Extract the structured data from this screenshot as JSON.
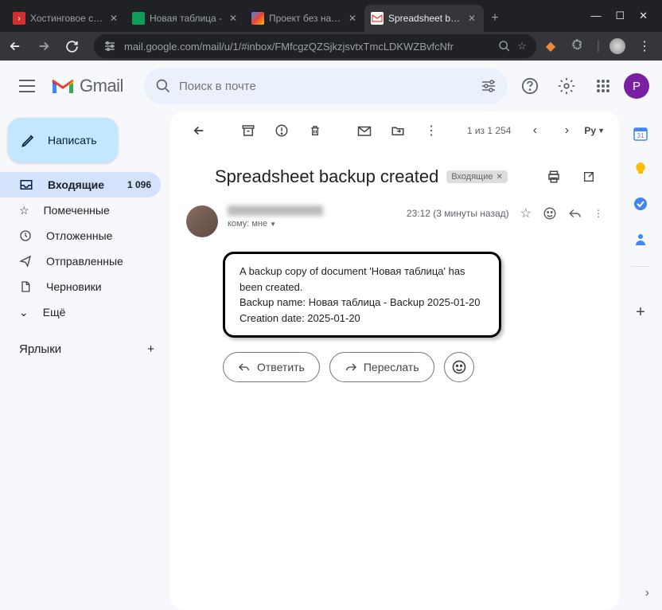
{
  "browser": {
    "tabs": [
      {
        "title": "Хостинговое со…",
        "icon_bg": "#d32f2f",
        "icon_text": ">"
      },
      {
        "title": "Новая таблица - ",
        "icon_bg": "#0f9d58",
        "icon_text": ""
      },
      {
        "title": "Проект без назв…",
        "icon_bg": "#4285f4",
        "icon_text": ""
      },
      {
        "title": "Spreadsheet back…",
        "icon_bg": "#fff",
        "icon_text": "M"
      }
    ],
    "url": "mail.google.com/mail/u/1/#inbox/FMfcgzQZSjkzjsvtxTmcLDKWZBvfcNfr"
  },
  "gmail": {
    "logo_text": "Gmail",
    "search_placeholder": "Поиск в почте",
    "compose": "Написать",
    "nav": [
      {
        "label": "Входящие",
        "count": "1 096",
        "icon": "inbox",
        "active": true
      },
      {
        "label": "Помеченные",
        "icon": "star"
      },
      {
        "label": "Отложенные",
        "icon": "clock"
      },
      {
        "label": "Отправленные",
        "icon": "send"
      },
      {
        "label": "Черновики",
        "icon": "draft"
      },
      {
        "label": "Ещё",
        "icon": "more"
      }
    ],
    "labels_header": "Ярлыки",
    "toolbar": {
      "count": "1 из 1 254",
      "lang": "Ру"
    },
    "subject": "Spreadsheet backup created",
    "label_chip": "Входящие",
    "time": "23:12 (3 минуты назад)",
    "to": "кому: мне",
    "body_line1": "A backup copy of document 'Новая таблица' has been created.",
    "body_line2": "Backup name: Новая таблица - Backup 2025-01-20",
    "body_line3": "Creation date: 2025-01-20",
    "reply": "Ответить",
    "forward": "Переслать",
    "avatar_letter": "P"
  }
}
